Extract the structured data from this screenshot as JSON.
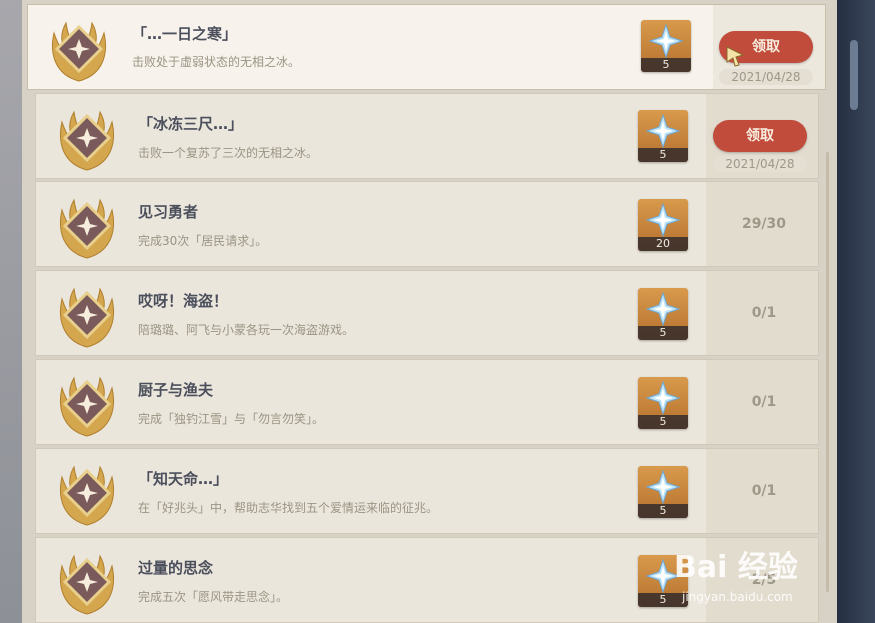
{
  "achievements": [
    {
      "title": "「…一日之寒」",
      "desc": "击败处于虚弱状态的无相之冰。",
      "reward_qty": "5",
      "claim_label": "领取",
      "date": "2021/04/28"
    },
    {
      "title": "「冰冻三尺…」",
      "desc": "击败一个复苏了三次的无相之冰。",
      "reward_qty": "5",
      "claim_label": "领取",
      "date": "2021/04/28"
    },
    {
      "title": "见习勇者",
      "desc": "完成30次「居民请求」。",
      "reward_qty": "20",
      "progress": "29/30"
    },
    {
      "title": "哎呀！海盗！",
      "desc": "陪璐璐、阿飞与小蒙各玩一次海盗游戏。",
      "reward_qty": "5",
      "progress": "0/1"
    },
    {
      "title": "厨子与渔夫",
      "desc": "完成「独钓江雪」与「勿言勿笑」。",
      "reward_qty": "5",
      "progress": "0/1"
    },
    {
      "title": "「知天命…」",
      "desc": "在「好兆头」中，帮助志华找到五个爱情运来临的征兆。",
      "reward_qty": "5",
      "progress": "0/1"
    },
    {
      "title": "过量的思念",
      "desc": "完成五次「愿风带走思念」。",
      "reward_qty": "5",
      "progress": "2/5"
    }
  ],
  "icons": {
    "emblem": "achievement-laurel-emblem-icon",
    "reward": "primogem-icon",
    "cursor": "pointer-cursor-icon"
  },
  "watermark": {
    "logo": "Bai 经验",
    "url": "jingyan.baidu.com"
  },
  "colors": {
    "claim_button": "#c24c3c",
    "panel": "#d8d2c6",
    "row": "#ebe6dc"
  }
}
